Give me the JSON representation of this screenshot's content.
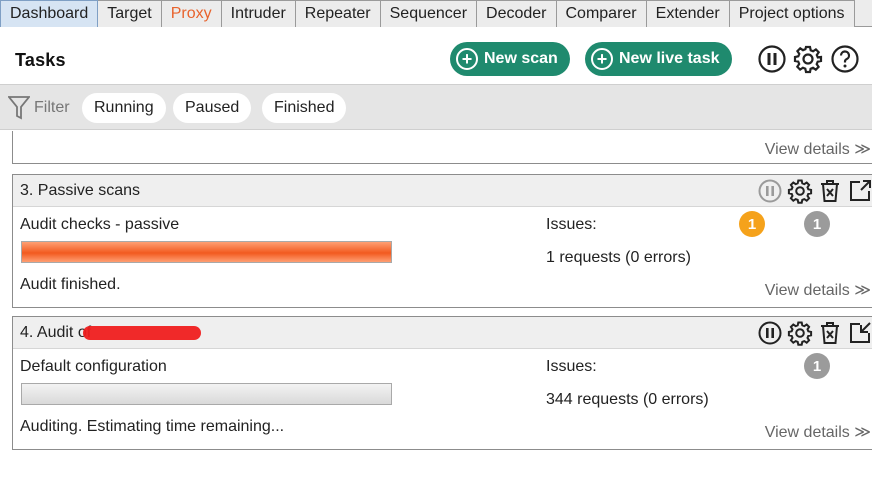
{
  "tabs": [
    {
      "label": "Dashboard",
      "active": true
    },
    {
      "label": "Target"
    },
    {
      "label": "Proxy",
      "highlight": true
    },
    {
      "label": "Intruder"
    },
    {
      "label": "Repeater"
    },
    {
      "label": "Sequencer"
    },
    {
      "label": "Decoder"
    },
    {
      "label": "Comparer"
    },
    {
      "label": "Extender"
    },
    {
      "label": "Project options"
    }
  ],
  "header": {
    "title": "Tasks",
    "new_scan": "New scan",
    "new_live_task": "New live task",
    "icons": [
      "pause-icon",
      "gear-icon",
      "help-icon"
    ]
  },
  "filter": {
    "label": "Filter",
    "chips": [
      "Running",
      "Paused",
      "Finished"
    ]
  },
  "tasks": [
    {
      "view_details": "View details"
    },
    {
      "title": "3. Passive scans",
      "subtitle": "Audit checks - passive",
      "issues_label": "Issues:",
      "progress": 1.0,
      "requests": "1 requests (0 errors)",
      "status": "Audit finished.",
      "badges": [
        "1",
        "1"
      ],
      "view_details": "View details"
    },
    {
      "title": "4. Audit of",
      "subtitle": "Default configuration",
      "issues_label": "Issues:",
      "progress": 0.0,
      "requests": "344 requests (0 errors)",
      "status": "Auditing. Estimating time remaining...",
      "badges": [
        "1"
      ],
      "view_details": "View details"
    }
  ],
  "colors": {
    "accent_green": "#1f8a6e",
    "progress_orange": "#f25a1f",
    "badge_orange": "#f5a21b",
    "badge_grey": "#9b9b9b",
    "proxy_tab": "#e8632d"
  }
}
